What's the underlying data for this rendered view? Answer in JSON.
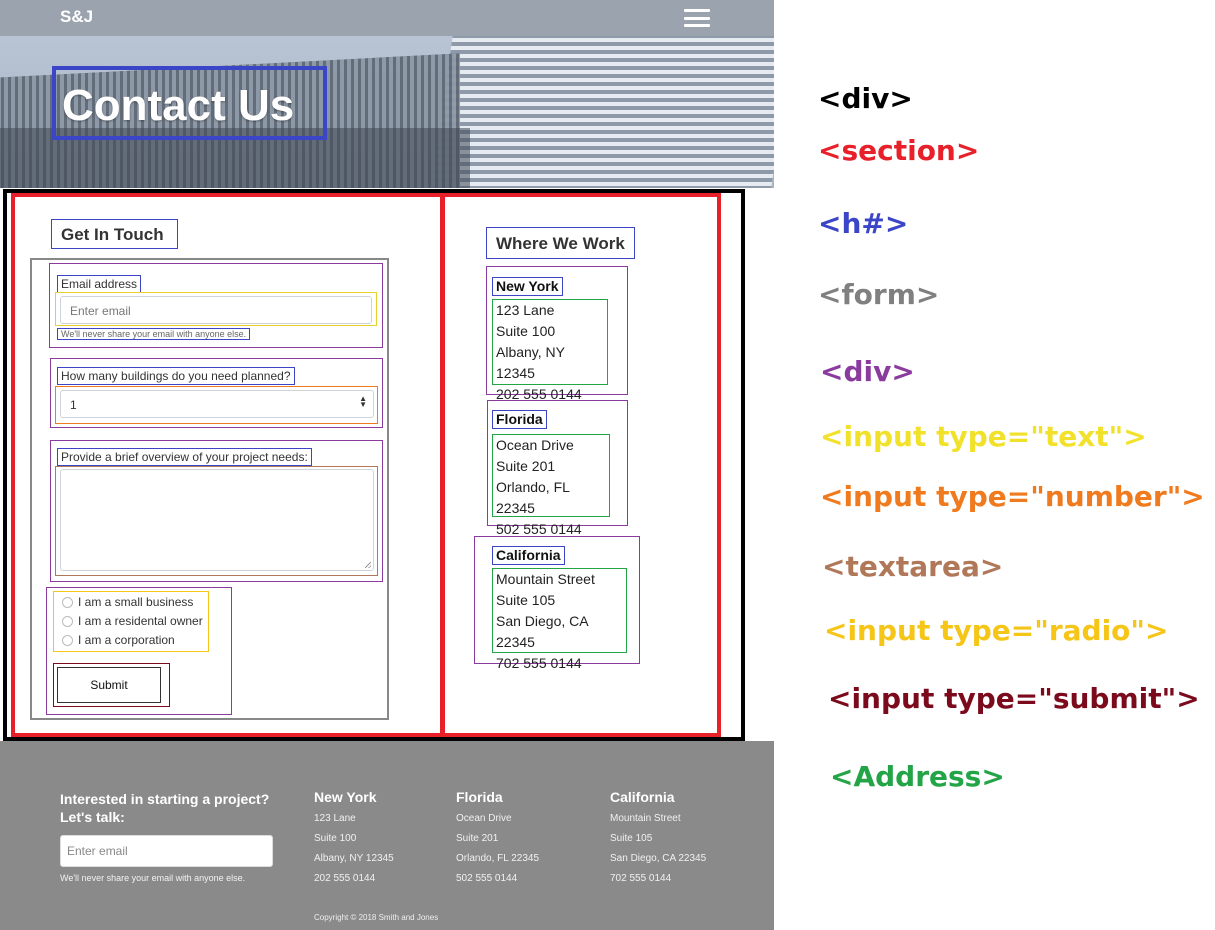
{
  "nav": {
    "brand": "S&J"
  },
  "hero": {
    "title": "Contact Us"
  },
  "contact": {
    "heading": "Get In Touch",
    "email": {
      "label": "Email address",
      "placeholder": "Enter email",
      "help": "We'll never share your email with anyone else."
    },
    "buildings": {
      "label": "How many buildings do you need planned?",
      "value": "1"
    },
    "overview": {
      "label": "Provide a brief overview of your project needs:"
    },
    "radios": [
      "I am a small business",
      "I am a residental owner",
      "I am a corporation"
    ],
    "submit": "Submit"
  },
  "where": {
    "heading": "Where We Work",
    "locations": [
      {
        "name": "New York",
        "lines": [
          "123 Lane",
          "Suite 100",
          "Albany, NY 12345",
          "202 555 0144"
        ]
      },
      {
        "name": "Florida",
        "lines": [
          "Ocean Drive",
          "Suite 201",
          "Orlando, FL 22345",
          "502 555 0144"
        ]
      },
      {
        "name": "California",
        "lines": [
          "Mountain Street",
          "Suite 105",
          "San Diego, CA 22345",
          "702 555 0144"
        ]
      }
    ]
  },
  "footer": {
    "cta": "Interested in starting a project? Let's talk:",
    "email_placeholder": "Enter email",
    "help": "We'll never share your email with anyone else.",
    "columns": [
      {
        "title": "New York",
        "lines": [
          "123 Lane",
          "Suite 100",
          "Albany, NY 12345",
          "202 555 0144"
        ]
      },
      {
        "title": "Florida",
        "lines": [
          "Ocean Drive",
          "Suite 201",
          "Orlando, FL 22345",
          "502 555 0144"
        ]
      },
      {
        "title": "California",
        "lines": [
          "Mountain Street",
          "Suite 105",
          "San Diego, CA 22345",
          "702 555 0144"
        ]
      }
    ],
    "copyright": "Copyright © 2018 Smith and Jones"
  },
  "legend": [
    {
      "text": "<div>",
      "color": "#000000"
    },
    {
      "text": "<section>",
      "color": "#e8202a"
    },
    {
      "text": "<h#>",
      "color": "#3b45c8"
    },
    {
      "text": "<form>",
      "color": "#808080"
    },
    {
      "text": "<div>",
      "color": "#8b3a9e"
    },
    {
      "text": "<input type=\"text\">",
      "color": "#f2e12a"
    },
    {
      "text": "<input type=\"number\">",
      "color": "#f07a1e"
    },
    {
      "text": "<textarea>",
      "color": "#b07858"
    },
    {
      "text": "<input type=\"radio\">",
      "color": "#f5c518"
    },
    {
      "text": "<input type=\"submit\">",
      "color": "#7a0a1c"
    },
    {
      "text": "<Address>",
      "color": "#22a447"
    }
  ]
}
